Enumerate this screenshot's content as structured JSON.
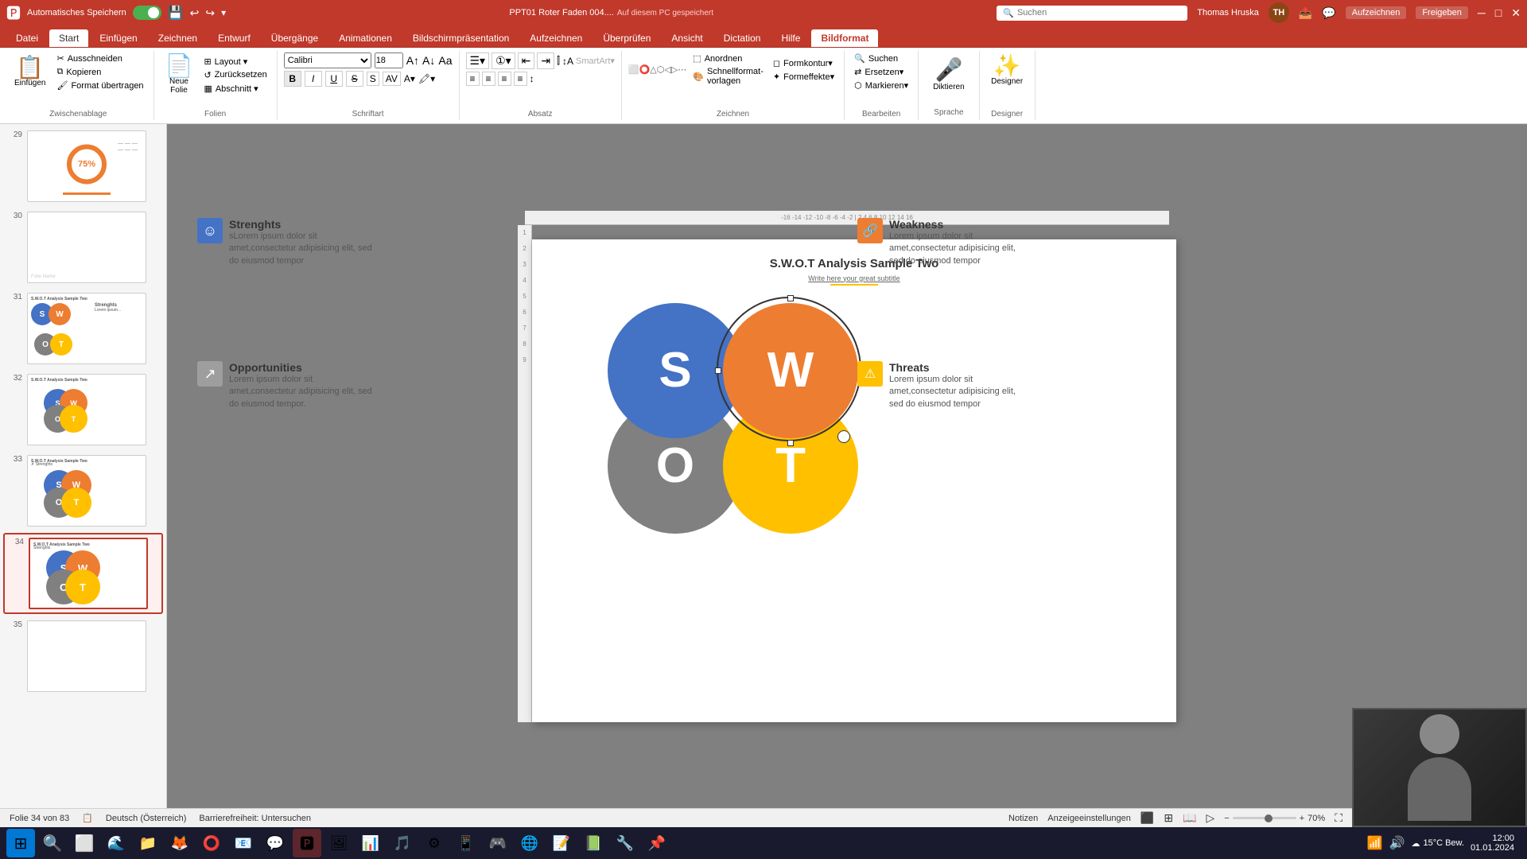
{
  "titlebar": {
    "autosave": "Automatisches Speichern",
    "filename": "PPT01 Roter Faden 004....",
    "save_location": "Auf diesem PC gespeichert",
    "search_placeholder": "Suchen",
    "user_name": "Thomas Hruska",
    "user_initials": "TH"
  },
  "ribbon_tabs": [
    {
      "id": "datei",
      "label": "Datei"
    },
    {
      "id": "start",
      "label": "Start",
      "active": true
    },
    {
      "id": "einfuegen",
      "label": "Einfügen"
    },
    {
      "id": "zeichnen",
      "label": "Zeichnen"
    },
    {
      "id": "entwurf",
      "label": "Entwurf"
    },
    {
      "id": "uebergaenge",
      "label": "Übergänge"
    },
    {
      "id": "animationen",
      "label": "Animationen"
    },
    {
      "id": "bildschirmpraesentation",
      "label": "Bildschirmpräsentation"
    },
    {
      "id": "aufzeichnen",
      "label": "Aufzeichnen"
    },
    {
      "id": "ueberpruefen",
      "label": "Überprüfen"
    },
    {
      "id": "ansicht",
      "label": "Ansicht"
    },
    {
      "id": "dictation",
      "label": "Dictation"
    },
    {
      "id": "hilfe",
      "label": "Hilfe"
    },
    {
      "id": "bildformat",
      "label": "Bildformat",
      "active_context": true
    }
  ],
  "ribbon_groups": {
    "zwischenablage": {
      "label": "Zwischenablage",
      "buttons": [
        "Einfügen",
        "Ausschneiden",
        "Kopieren",
        "Format übertragen"
      ]
    },
    "folien": {
      "label": "Folien",
      "buttons": [
        "Neue Folie",
        "Layout",
        "Zurücksetzen",
        "Abschnitt"
      ]
    },
    "schriftart": {
      "label": "Schriftart"
    },
    "absatz": {
      "label": "Absatz"
    },
    "zeichnen": {
      "label": "Zeichnen",
      "buttons": [
        "Anordnen",
        "Schnellformatvorlagen",
        "Formkontur",
        "Formeffekte"
      ]
    },
    "bearbeiten": {
      "label": "Bearbeiten",
      "buttons": [
        "Suchen",
        "Ersetzen",
        "Markieren"
      ]
    },
    "sprache": {
      "label": "Sprache",
      "buttons": [
        "Diktieren"
      ]
    },
    "designer": {
      "label": "Designer",
      "buttons": [
        "Designer"
      ]
    }
  },
  "slides": [
    {
      "number": "29",
      "has_content": true,
      "content_type": "donut_chart"
    },
    {
      "number": "30",
      "has_content": false
    },
    {
      "number": "31",
      "has_content": true,
      "content_type": "swot_small"
    },
    {
      "number": "32",
      "has_content": true,
      "content_type": "swot_medium"
    },
    {
      "number": "33",
      "has_content": true,
      "content_type": "swot_medium2"
    },
    {
      "number": "34",
      "has_content": true,
      "content_type": "swot_large",
      "active": true
    },
    {
      "number": "35",
      "has_content": false
    }
  ],
  "active_slide": {
    "title": "S.W.O.T Analysis Sample Two",
    "subtitle": "Write here your great subtitle",
    "swot": {
      "s_label": "S",
      "w_label": "W",
      "o_label": "O",
      "t_label": "T"
    },
    "strengths": {
      "heading": "Strenghts",
      "text": "sLorem ipsum dolor sit amet,consectetur adipisicing elit, sed do eiusmod tempor"
    },
    "weakness": {
      "heading": "Weakness",
      "text": "Lorem ipsum dolor sit amet,consectetur adipisicing elit, sed do eiusmod tempor"
    },
    "opportunities": {
      "heading": "Opportunities",
      "text": "Lorem ipsum dolor sit amet,consectetur adipisicing elit, sed do eiusmod tempor."
    },
    "threats": {
      "heading": "Threats",
      "text": "Lorem ipsum dolor sit amet,consectetur adipisicing elit, sed do eiusmod tempor"
    }
  },
  "status_bar": {
    "slide_info": "Folie 34 von 83",
    "accessibility": "Barrierefreiheit: Untersuchen",
    "notes": "Notizen",
    "view_settings": "Anzeigeeinstellungen",
    "language": "Deutsch (Österreich)"
  },
  "taskbar": {
    "time": "15°C Bew.",
    "start_icon": "⊞"
  },
  "dictation_button": "Diktieren",
  "designer_button": "Designer",
  "colors": {
    "accent_red": "#c0392b",
    "swot_blue": "#4472c4",
    "swot_orange": "#ed7d31",
    "swot_grey": "#808080",
    "swot_yellow": "#ffc000"
  }
}
